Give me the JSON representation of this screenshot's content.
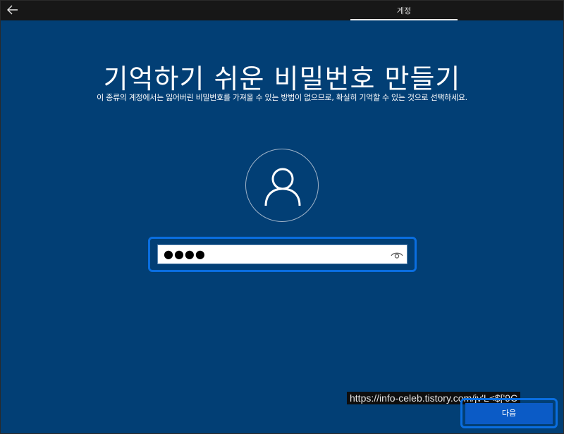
{
  "titlebar": {
    "back_icon": "arrow-left-icon",
    "tab_label": "계정"
  },
  "page": {
    "title": "기억하기 쉬운 비밀번호 만들기",
    "subtitle": "이 종류의 계정에서는 잃어버린 비밀번호를 가져올 수 있는 방법이 없으므로, 확실히 기억할 수 있는 것으로 선택하세요."
  },
  "avatar": {
    "icon": "user-icon"
  },
  "password": {
    "value": "●●●●",
    "reveal_icon": "eye-icon"
  },
  "watermark": {
    "text": "https://info-celeb.tistory.com/jv'L<$['9C"
  },
  "footer": {
    "next_label": "다음"
  },
  "colors": {
    "background": "#023f75",
    "titlebar": "#171717",
    "highlight": "#0a6ee0",
    "next_button": "#0b5bc6"
  }
}
